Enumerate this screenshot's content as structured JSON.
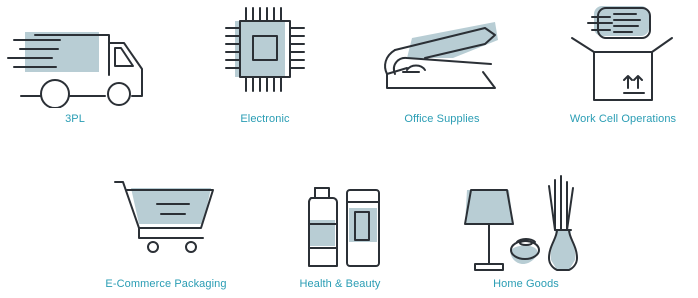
{
  "colors": {
    "label": "#2a9db4",
    "icon_fill": "#b8cdd4",
    "icon_stroke": "#2b3036"
  },
  "industries": [
    {
      "label": "3PL",
      "icon": "delivery-truck-icon"
    },
    {
      "label": "Electronic",
      "icon": "microchip-icon"
    },
    {
      "label": "Office Supplies",
      "icon": "stapler-icon"
    },
    {
      "label": "Work Cell Operations",
      "icon": "open-box-icon"
    },
    {
      "label": "E-Commerce Packaging",
      "icon": "shopping-cart-icon"
    },
    {
      "label": "Health & Beauty",
      "icon": "cosmetic-bottles-icon"
    },
    {
      "label": "Home Goods",
      "icon": "lamp-and-vases-icon"
    }
  ]
}
